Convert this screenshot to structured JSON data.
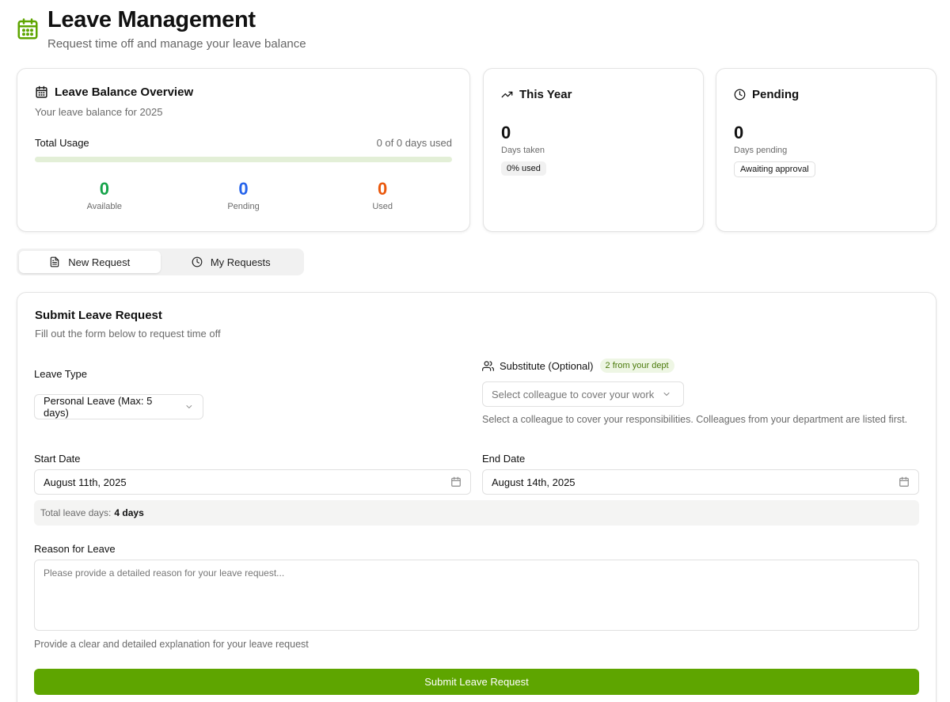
{
  "header": {
    "title": "Leave Management",
    "subtitle": "Request time off and manage your leave balance"
  },
  "overview": {
    "title": "Leave Balance Overview",
    "subtitle": "Your leave balance for 2025",
    "usage_label": "Total Usage",
    "usage_value": "0 of 0 days used",
    "usage_progress_percent": 0,
    "stats": [
      {
        "value": "0",
        "label": "Available",
        "color": "#16a34a"
      },
      {
        "value": "0",
        "label": "Pending",
        "color": "#2563eb"
      },
      {
        "value": "0",
        "label": "Used",
        "color": "#ea580c"
      }
    ]
  },
  "this_year": {
    "title": "This Year",
    "value": "0",
    "label": "Days taken",
    "badge": "0% used"
  },
  "pending": {
    "title": "Pending",
    "value": "0",
    "label": "Days pending",
    "badge": "Awaiting approval"
  },
  "tabs": [
    {
      "label": "New Request",
      "active": true
    },
    {
      "label": "My Requests",
      "active": false
    }
  ],
  "form": {
    "title": "Submit Leave Request",
    "subtitle": "Fill out the form below to request time off",
    "leave_type_label": "Leave Type",
    "leave_type_value": "Personal Leave (Max: 5 days)",
    "substitute_label": "Substitute (Optional)",
    "substitute_badge": "2 from your dept",
    "substitute_placeholder": "Select colleague to cover your work",
    "substitute_help": "Select a colleague to cover your responsibilities. Colleagues from your department are listed first.",
    "start_label": "Start Date",
    "start_value": "August 11th, 2025",
    "end_label": "End Date",
    "end_value": "August 14th, 2025",
    "total_label": "Total leave days:",
    "total_value": "4 days",
    "reason_label": "Reason for Leave",
    "reason_placeholder": "Please provide a detailed reason for your leave request...",
    "reason_help": "Provide a clear and detailed explanation for your leave request",
    "submit_label": "Submit Leave Request"
  },
  "colors": {
    "brand": "#5ea500"
  }
}
